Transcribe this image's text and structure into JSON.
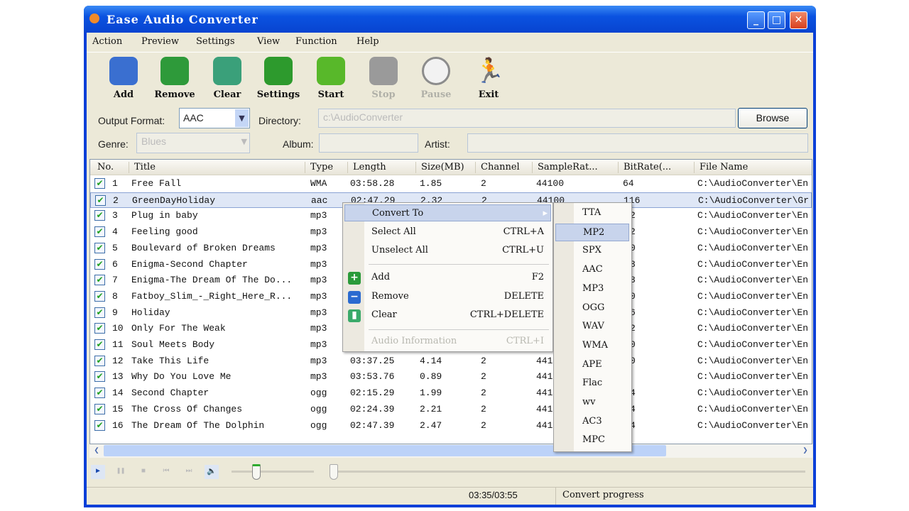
{
  "window": {
    "title": "Ease Audio Converter",
    "minimize": "_",
    "maximize": "□",
    "close": "✕"
  },
  "menu": [
    "Action",
    "Preview",
    "Settings",
    "View",
    "Function",
    "Help"
  ],
  "toolbar": [
    {
      "label": "Add",
      "icon": "add-pencil-icon",
      "enabled": true,
      "color": "#3a6fd0"
    },
    {
      "label": "Remove",
      "icon": "remove-check-icon",
      "enabled": true,
      "color": "#2e9a3a"
    },
    {
      "label": "Clear",
      "icon": "clear-bin-icon",
      "enabled": true,
      "color": "#3aa07a"
    },
    {
      "label": "Settings",
      "icon": "gears-icon",
      "enabled": true,
      "color": "#2d9a2d"
    },
    {
      "label": "Start",
      "icon": "start-arrow-icon",
      "enabled": true,
      "color": "#58b82a"
    },
    {
      "label": "Stop",
      "icon": "stop-cone-icon",
      "enabled": false,
      "color": "#9a9a9a"
    },
    {
      "label": "Pause",
      "icon": "clock-icon",
      "enabled": false,
      "color": "#8c8c8c"
    },
    {
      "label": "Exit",
      "icon": "running-man-icon",
      "enabled": true,
      "color": "#1a9a1a"
    }
  ],
  "options": {
    "output_format_label": "Output Format:",
    "output_format": "AAC",
    "directory_label": "Directory:",
    "directory": "c:\\AudioConverter",
    "browse": "Browse",
    "genre_label": "Genre:",
    "genre": "Blues",
    "album_label": "Album:",
    "album": "",
    "artist_label": "Artist:",
    "artist": ""
  },
  "columns": [
    "No.",
    "Title",
    "Type",
    "Length",
    "Size(MB)",
    "Channel",
    "SampleRat...",
    "BitRate(...",
    "File Name"
  ],
  "rows": [
    {
      "no": "1",
      "title": "Free Fall",
      "type": "WMA",
      "length": "03:58.28",
      "size": "1.85",
      "channel": "2",
      "samplerate": "44100",
      "bitrate": "64",
      "file": "C:\\AudioConverter\\En"
    },
    {
      "no": "2",
      "title": "GreenDayHoliday",
      "type": "aac",
      "length": "02:47.29",
      "size": "2.32",
      "channel": "2",
      "samplerate": "44100",
      "bitrate": "116",
      "file": "C:\\AudioConverter\\Gr"
    },
    {
      "no": "3",
      "title": "Plug in baby",
      "type": "mp3",
      "length": "",
      "size": "",
      "channel": "",
      "samplerate": "",
      "bitrate": "2",
      "file": "C:\\AudioConverter\\En"
    },
    {
      "no": "4",
      "title": "Feeling good",
      "type": "mp3",
      "length": "",
      "size": "",
      "channel": "",
      "samplerate": "",
      "bitrate": "2",
      "file": "C:\\AudioConverter\\En"
    },
    {
      "no": "5",
      "title": "Boulevard of Broken Dreams",
      "type": "mp3",
      "length": "",
      "size": "",
      "channel": "",
      "samplerate": "",
      "bitrate": "0",
      "file": "C:\\AudioConverter\\En"
    },
    {
      "no": "6",
      "title": "Enigma-Second Chapter",
      "type": "mp3",
      "length": "",
      "size": "",
      "channel": "",
      "samplerate": "",
      "bitrate": "8",
      "file": "C:\\AudioConverter\\En"
    },
    {
      "no": "7",
      "title": "Enigma-The Dream Of The Do...",
      "type": "mp3",
      "length": "",
      "size": "",
      "channel": "",
      "samplerate": "",
      "bitrate": "8",
      "file": "C:\\AudioConverter\\En"
    },
    {
      "no": "8",
      "title": "Fatboy_Slim_-_Right_Here_R...",
      "type": "mp3",
      "length": "",
      "size": "",
      "channel": "",
      "samplerate": "",
      "bitrate": "0",
      "file": "C:\\AudioConverter\\En"
    },
    {
      "no": "9",
      "title": "Holiday",
      "type": "mp3",
      "length": "",
      "size": "",
      "channel": "",
      "samplerate": "",
      "bitrate": "6",
      "file": "C:\\AudioConverter\\En"
    },
    {
      "no": "10",
      "title": "Only For The Weak",
      "type": "mp3",
      "length": "",
      "size": "",
      "channel": "",
      "samplerate": "",
      "bitrate": "2",
      "file": "C:\\AudioConverter\\En"
    },
    {
      "no": "11",
      "title": "Soul Meets Body",
      "type": "mp3",
      "length": "",
      "size": "",
      "channel": "",
      "samplerate": "",
      "bitrate": "0",
      "file": "C:\\AudioConverter\\En"
    },
    {
      "no": "12",
      "title": "Take This Life",
      "type": "mp3",
      "length": "03:37.25",
      "size": "4.14",
      "channel": "2",
      "samplerate": "441",
      "bitrate": "0",
      "file": "C:\\AudioConverter\\En"
    },
    {
      "no": "13",
      "title": "Why Do You Love Me",
      "type": "mp3",
      "length": "03:53.76",
      "size": "0.89",
      "channel": "2",
      "samplerate": "441",
      "bitrate": "",
      "file": "C:\\AudioConverter\\En"
    },
    {
      "no": "14",
      "title": "Second Chapter",
      "type": "ogg",
      "length": "02:15.29",
      "size": "1.99",
      "channel": "2",
      "samplerate": "441",
      "bitrate": "4",
      "file": "C:\\AudioConverter\\En"
    },
    {
      "no": "15",
      "title": "The Cross Of Changes",
      "type": "ogg",
      "length": "02:24.39",
      "size": "2.21",
      "channel": "2",
      "samplerate": "441",
      "bitrate": "4",
      "file": "C:\\AudioConverter\\En"
    },
    {
      "no": "16",
      "title": "The Dream Of The Dolphin",
      "type": "ogg",
      "length": "02:47.39",
      "size": "2.47",
      "channel": "2",
      "samplerate": "441",
      "bitrate": "4",
      "file": "C:\\AudioConverter\\En"
    }
  ],
  "selected_row": 2,
  "context_menu": [
    {
      "label": "Convert To",
      "shortcut": "",
      "arrow": "▸",
      "highlighted": true
    },
    {
      "label": "Select All",
      "shortcut": "CTRL+A"
    },
    {
      "label": "Unselect All",
      "shortcut": "CTRL+U"
    },
    {
      "label": "Add",
      "shortcut": "F2",
      "icon": "add-icon",
      "icon_glyph": "+",
      "color": "#2a9a3a"
    },
    {
      "label": "Remove",
      "shortcut": "DELETE",
      "icon": "remove-icon",
      "icon_glyph": "−",
      "color": "#2a6ad0"
    },
    {
      "label": "Clear",
      "shortcut": "CTRL+DELETE",
      "icon": "clear-icon",
      "icon_glyph": "▮",
      "color": "#3aaa6a"
    },
    {
      "label": "Audio Information",
      "shortcut": "CTRL+I",
      "disabled": true
    }
  ],
  "submenu": [
    "TTA",
    "MP2",
    "SPX",
    "AAC",
    "MP3",
    "OGG",
    "WAV",
    "WMA",
    "APE",
    "Flac",
    "wv",
    "AC3",
    "MPC"
  ],
  "submenu_highlighted": "MP2",
  "player": {
    "volume": 0.3,
    "position": 0.0
  },
  "status": {
    "time": "03:35/03:55",
    "text": "Convert progress"
  }
}
